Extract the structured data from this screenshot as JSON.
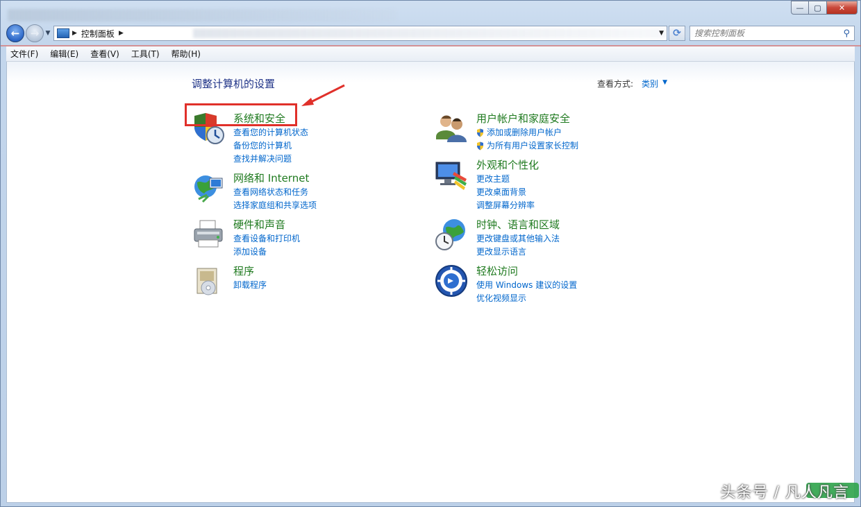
{
  "window": {
    "close_label": "✕",
    "max_label": "▢",
    "min_label": "—"
  },
  "nav": {
    "back_label": "←",
    "forward_label": "→",
    "breadcrumb": "控制面板",
    "search_placeholder": "搜索控制面板"
  },
  "menu": [
    {
      "label": "文件(F)"
    },
    {
      "label": "编辑(E)"
    },
    {
      "label": "查看(V)"
    },
    {
      "label": "工具(T)"
    },
    {
      "label": "帮助(H)"
    }
  ],
  "content": {
    "title": "调整计算机的设置",
    "view_by_label": "查看方式:",
    "view_by_value": "类别",
    "left_categories": [
      {
        "title": "系统和安全",
        "icon": "shield-clock-icon",
        "links": [
          "查看您的计算机状态",
          "备份您的计算机",
          "查找并解决问题"
        ]
      },
      {
        "title": "网络和 Internet",
        "icon": "globe-network-icon",
        "links": [
          "查看网络状态和任务",
          "选择家庭组和共享选项"
        ]
      },
      {
        "title": "硬件和声音",
        "icon": "printer-icon",
        "links": [
          "查看设备和打印机",
          "添加设备"
        ]
      },
      {
        "title": "程序",
        "icon": "programs-disc-icon",
        "links": [
          "卸载程序"
        ]
      }
    ],
    "right_categories": [
      {
        "title": "用户帐户和家庭安全",
        "icon": "users-icon",
        "links": [
          "添加或删除用户帐户",
          "为所有用户设置家长控制"
        ],
        "shield_links": true
      },
      {
        "title": "外观和个性化",
        "icon": "monitor-palette-icon",
        "links": [
          "更改主题",
          "更改桌面背景",
          "调整屏幕分辨率"
        ]
      },
      {
        "title": "时钟、语言和区域",
        "icon": "globe-clock-icon",
        "links": [
          "更改键盘或其他输入法",
          "更改显示语言"
        ]
      },
      {
        "title": "轻松访问",
        "icon": "ease-of-access-icon",
        "links": [
          "使用 Windows 建议的设置",
          "优化视频显示"
        ]
      }
    ]
  },
  "annotation": {
    "highlight_color": "#e0302a"
  },
  "watermark": "头条号 / 凡人凡言"
}
